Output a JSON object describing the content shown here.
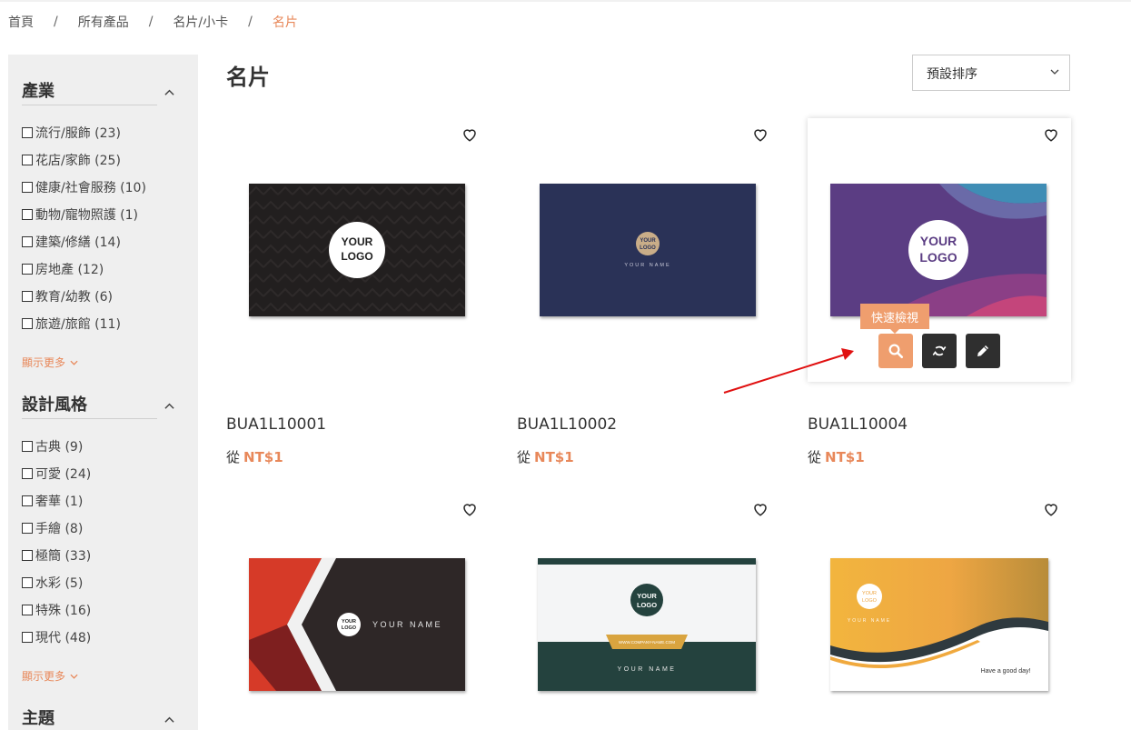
{
  "breadcrumb": {
    "items": [
      "首頁",
      "所有產品",
      "名片/小卡"
    ],
    "separator": "/",
    "current": "名片"
  },
  "sidebar": {
    "facets": [
      {
        "title": "產業",
        "options": [
          "流行/服飾 (23)",
          "花店/家飾 (25)",
          "健康/社會服務 (10)",
          "動物/寵物照護 (1)",
          "建築/修繕 (14)",
          "房地產 (12)",
          "教育/幼教 (6)",
          "旅遊/旅館 (11)"
        ],
        "more": "顯示更多"
      },
      {
        "title": "設計風格",
        "options": [
          "古典 (9)",
          "可愛 (24)",
          "奢華 (1)",
          "手繪 (8)",
          "極簡 (33)",
          "水彩 (5)",
          "特殊 (16)",
          "現代 (48)"
        ],
        "more": "顯示更多"
      },
      {
        "title": "主題"
      }
    ]
  },
  "main": {
    "title": "名片",
    "sort": {
      "selected": "預設排序"
    },
    "price_prefix": "從",
    "products": [
      {
        "sku": "BUA1L10001",
        "price": "NT$1",
        "card_text": [
          "YOUR",
          "LOGO"
        ]
      },
      {
        "sku": "BUA1L10002",
        "price": "NT$1",
        "card_text": [
          "YOUR",
          "LOGO",
          "YOUR NAME"
        ]
      },
      {
        "sku": "BUA1L10004",
        "price": "NT$1",
        "card_text": [
          "YOUR",
          "LOGO"
        ]
      },
      {
        "card_text": [
          "YOUR",
          "LOGO",
          "YOUR NAME"
        ]
      },
      {
        "card_text": [
          "YOUR",
          "LOGO",
          "WWW.COMPANY-NAME.COM",
          "YOUR NAME"
        ]
      },
      {
        "card_text": [
          "YOUR",
          "LOGO",
          "YOUR NAME",
          "Have a good day!"
        ]
      }
    ],
    "tooltip": "快速檢視"
  },
  "colors": {
    "accent": "#e8885a",
    "button_orange": "#ef9e6e",
    "button_dark": "#2f2f2f",
    "sidebar_bg": "#efefef",
    "annotation_arrow": "#e01010"
  },
  "icons": {
    "wishlist": "heart-outline-icon",
    "quick_view": "search-icon",
    "swap": "refresh-icon",
    "customize": "pencil-icon",
    "collapse": "chevron-up-icon",
    "expand": "chevron-down-icon"
  }
}
